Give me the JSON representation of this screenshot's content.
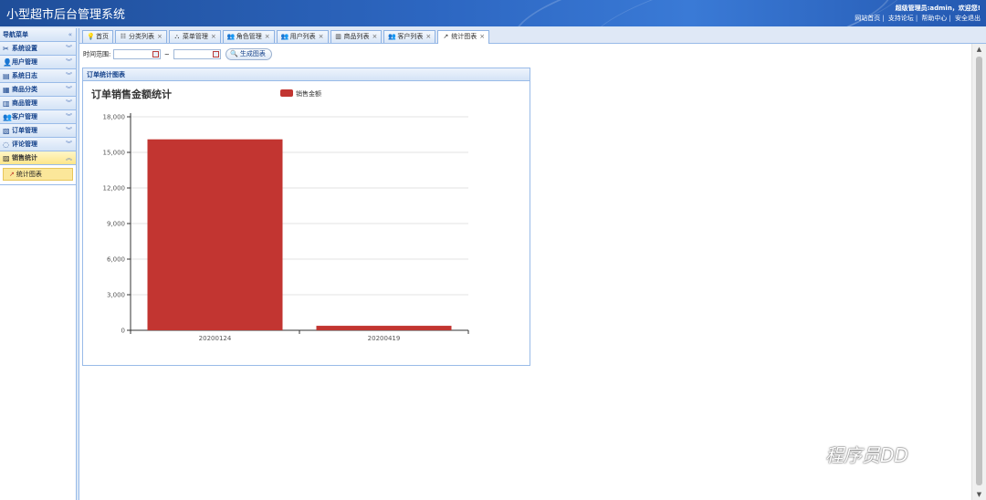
{
  "app": {
    "title": "小型超市后台管理系统",
    "welcome": "超级管理员:admin，欢迎您!",
    "links": [
      "网站首页",
      "支持论坛",
      "帮助中心",
      "安全退出"
    ]
  },
  "sidebar": {
    "nav_title": "导航菜单",
    "collapse_icon": "double-chevron-left-icon",
    "groups": [
      {
        "label": "系统设置",
        "icon": "tools-icon"
      },
      {
        "label": "用户管理",
        "icon": "user-icon"
      },
      {
        "label": "系统日志",
        "icon": "log-icon"
      },
      {
        "label": "商品分类",
        "icon": "category-icon"
      },
      {
        "label": "商品管理",
        "icon": "goods-icon"
      },
      {
        "label": "客户管理",
        "icon": "customer-icon"
      },
      {
        "label": "订单管理",
        "icon": "order-icon"
      },
      {
        "label": "评论管理",
        "icon": "comment-icon"
      },
      {
        "label": "销售统计",
        "icon": "chart-icon",
        "open": true
      }
    ],
    "open_items": [
      {
        "label": "统计图表",
        "icon": "line-chart-icon",
        "selected": true
      }
    ]
  },
  "tabs": [
    {
      "label": "首页",
      "icon": "home-icon",
      "closable": false
    },
    {
      "label": "分类列表",
      "icon": "list-icon",
      "closable": true
    },
    {
      "label": "菜单管理",
      "icon": "menu-icon",
      "closable": true
    },
    {
      "label": "角色管理",
      "icon": "role-icon",
      "closable": true
    },
    {
      "label": "用户列表",
      "icon": "users-icon",
      "closable": true
    },
    {
      "label": "商品列表",
      "icon": "goods-list-icon",
      "closable": true
    },
    {
      "label": "客户列表",
      "icon": "customer-list-icon",
      "closable": true
    },
    {
      "label": "统计图表",
      "icon": "line-chart-icon",
      "closable": true,
      "active": true
    }
  ],
  "toolbar": {
    "range_label": "时间范围:",
    "start_value": "",
    "dash": "~",
    "end_value": "",
    "generate_label": "生成图表"
  },
  "panel": {
    "title": "订单统计图表"
  },
  "chart_data": {
    "type": "bar",
    "title": "订单销售金额统计",
    "categories": [
      "20200124",
      "20200419"
    ],
    "series": [
      {
        "name": "销售金额",
        "values": [
          16100,
          380
        ]
      }
    ],
    "yticks": [
      "0",
      "3,000",
      "6,000",
      "9,000",
      "12,000",
      "15,000",
      "18,000"
    ],
    "ylim": [
      0,
      18000
    ],
    "grid": true,
    "legend": "top-center",
    "bar_color": "#c23531"
  },
  "watermark": "程序员DD"
}
